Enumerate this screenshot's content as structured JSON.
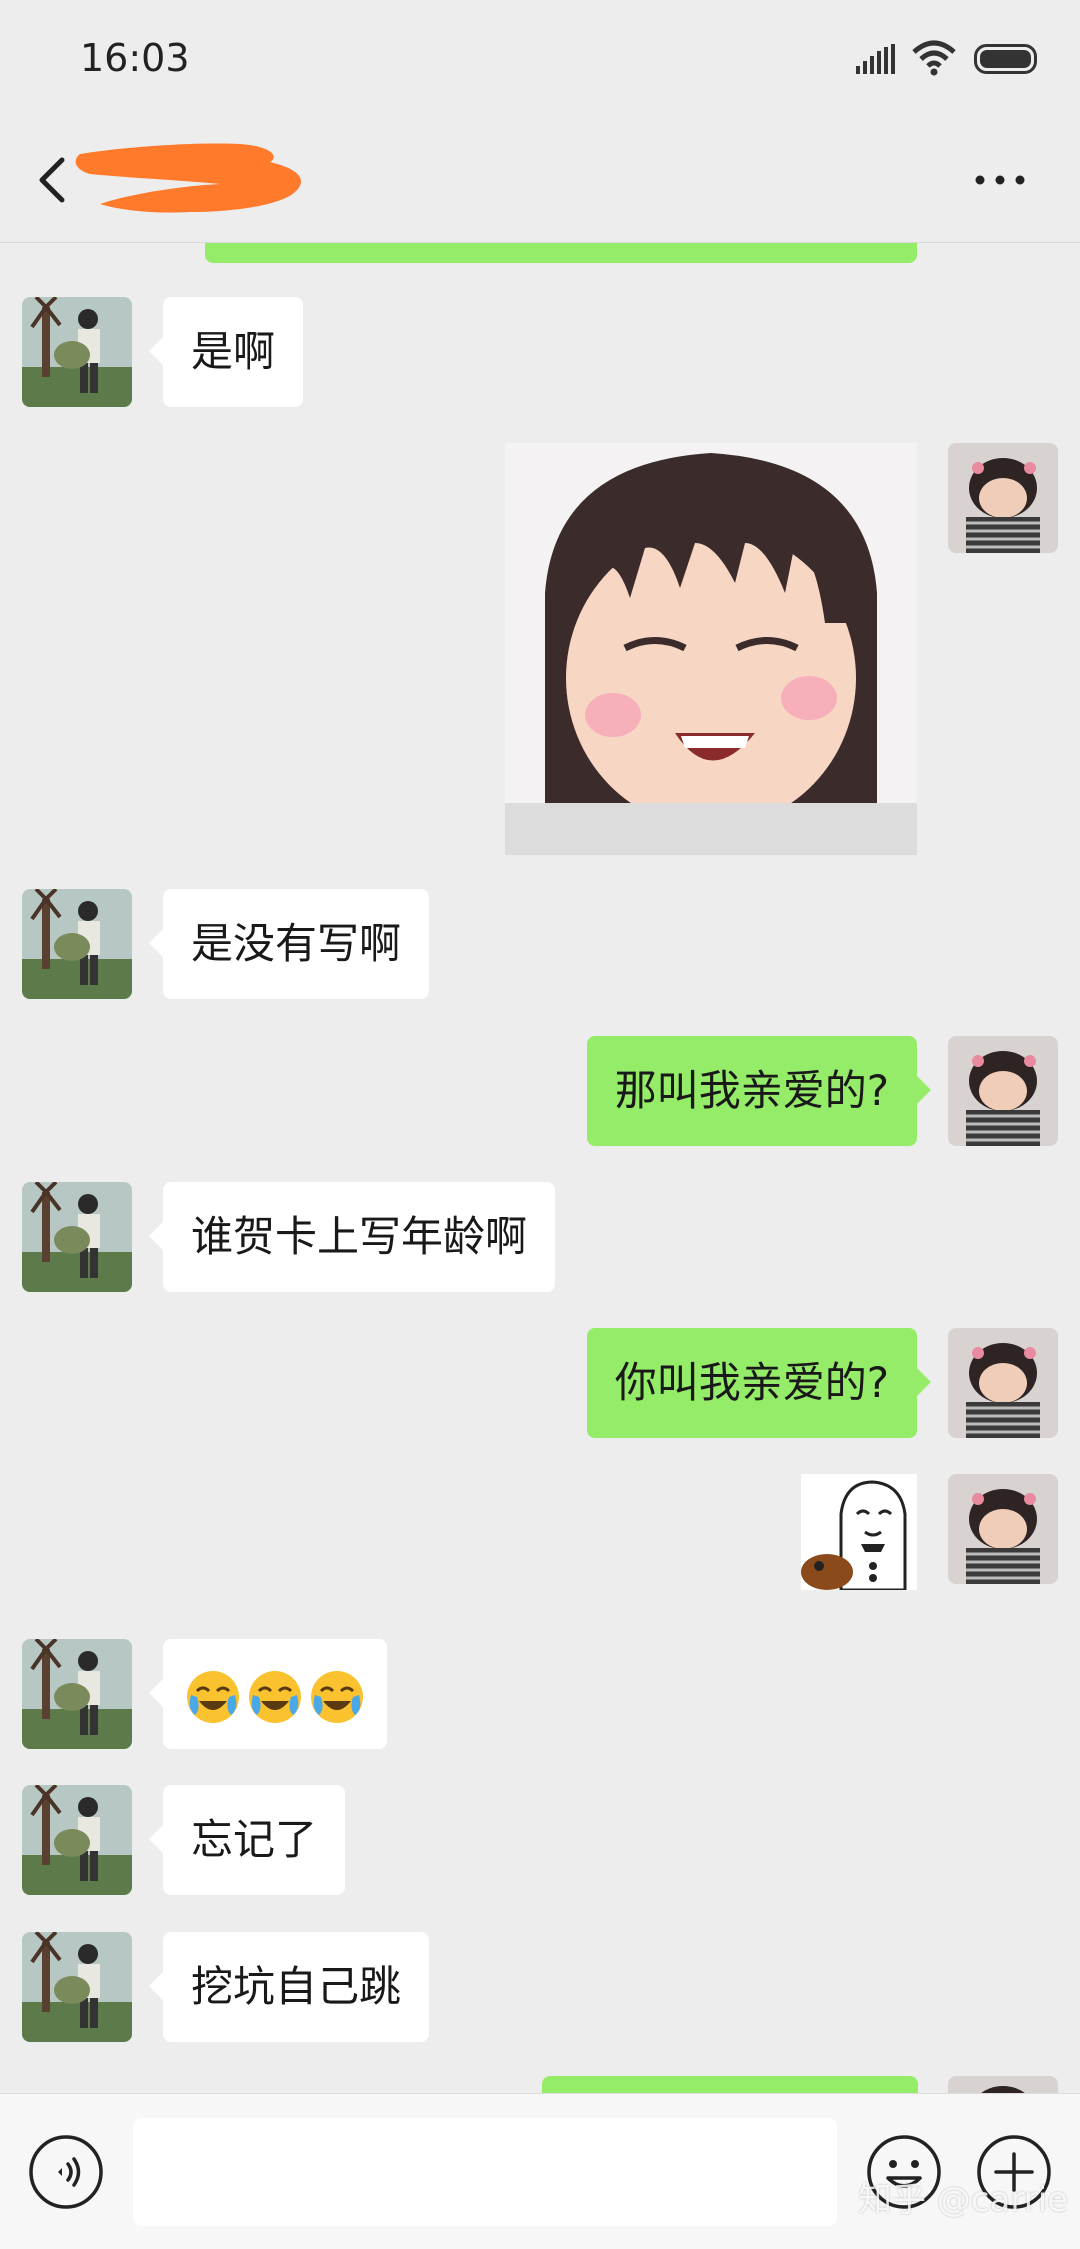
{
  "status_bar": {
    "time": "16:03"
  },
  "header": {
    "title_redacted": true
  },
  "messages": [
    {
      "side": "left",
      "type": "text",
      "text": "是啊"
    },
    {
      "side": "right",
      "type": "sticker",
      "description": "smiling-girl-sticker"
    },
    {
      "side": "left",
      "type": "text",
      "text": "是没有写啊"
    },
    {
      "side": "right",
      "type": "text",
      "text": "那叫我亲爱的?"
    },
    {
      "side": "left",
      "type": "text",
      "text": "谁贺卡上写年龄啊"
    },
    {
      "side": "right",
      "type": "text",
      "text": "你叫我亲爱的?"
    },
    {
      "side": "right",
      "type": "sticker",
      "description": "panda-meme-sticker"
    },
    {
      "side": "left",
      "type": "emoji",
      "count": 3,
      "icon": "crying-laughing-emoji"
    },
    {
      "side": "left",
      "type": "text",
      "text": "忘记了"
    },
    {
      "side": "left",
      "type": "text",
      "text": "挖坑自己跳"
    }
  ],
  "input": {
    "value": ""
  },
  "watermark": "知乎 @carrie",
  "colors": {
    "background": "#ededed",
    "outgoing_bubble": "#95ec69",
    "incoming_bubble": "#ffffff",
    "redaction": "#ff7a2b"
  }
}
